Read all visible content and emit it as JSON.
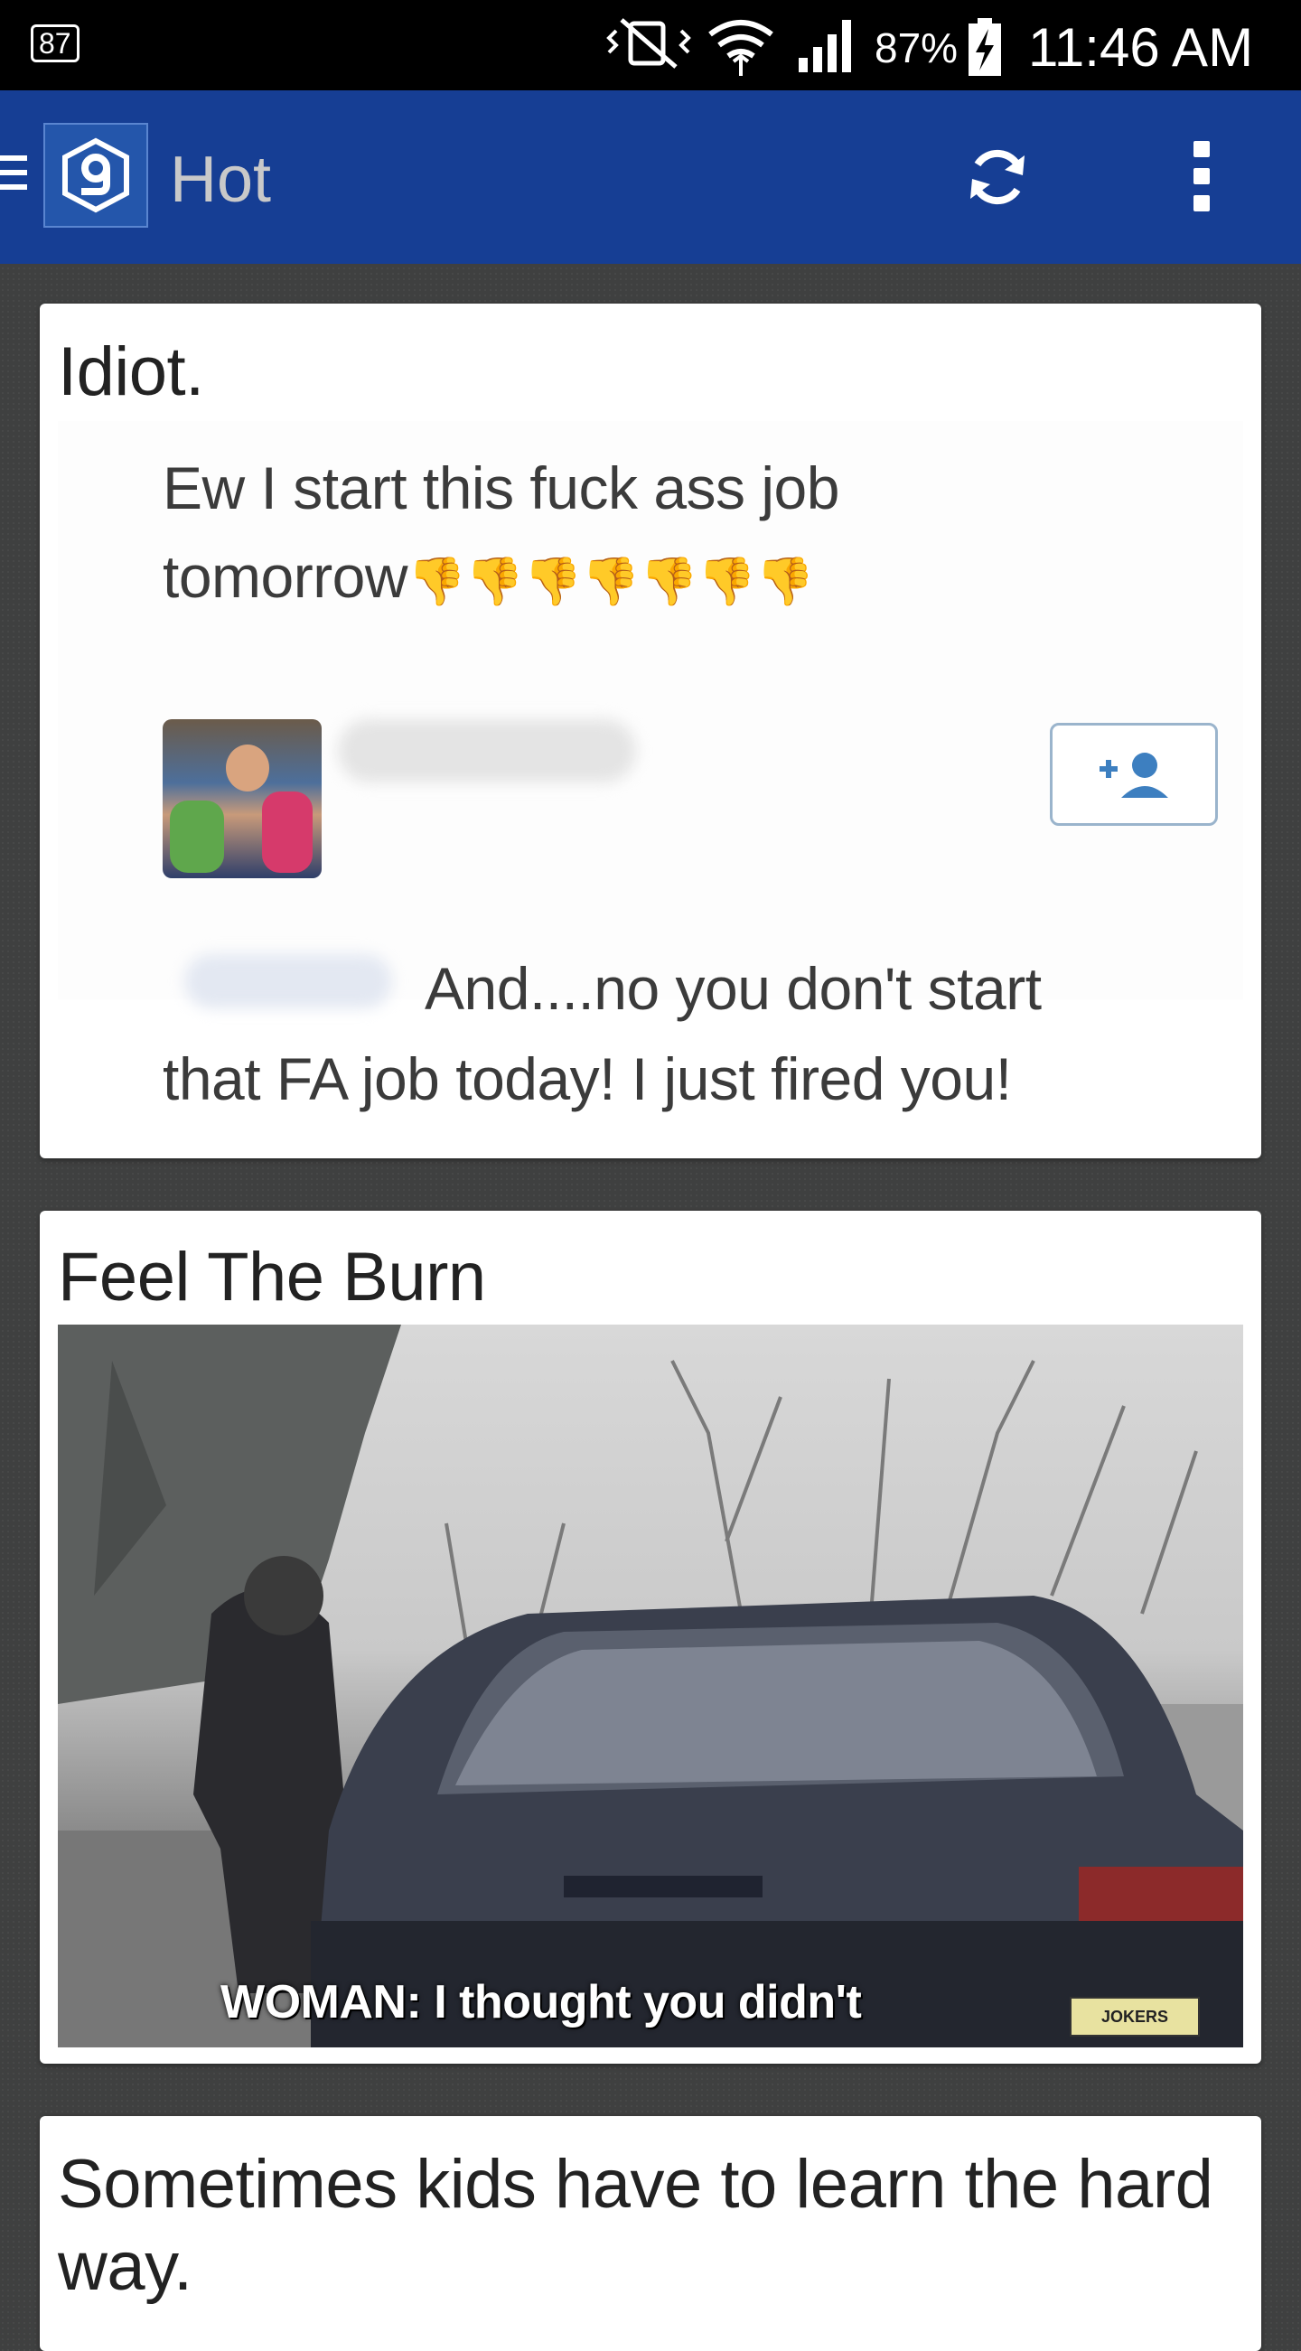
{
  "status_bar": {
    "notification_count": "87",
    "battery_percent": "87%",
    "time": "11:46 AM"
  },
  "app_bar": {
    "title": "Hot",
    "logo_glyph": "9",
    "icons": [
      "menu-icon",
      "app-logo-icon",
      "refresh-icon",
      "overflow-menu-icon"
    ],
    "color": "#163e94"
  },
  "posts": [
    {
      "title": "Idiot.",
      "image_text": {
        "line1": "Ew I start this fuck ass job",
        "line2": "tomorrow",
        "emoji": "👎👎👎👎👎👎👎",
        "reply_line1": "And....no you don't start",
        "reply_line2": "that FA job today!  I just fired you!"
      }
    },
    {
      "title": "Feel The Burn",
      "image_caption": "WOMAN: I thought you didn't",
      "watermark": "JOKERS"
    },
    {
      "title": "Sometimes kids have to learn the hard way."
    }
  ]
}
